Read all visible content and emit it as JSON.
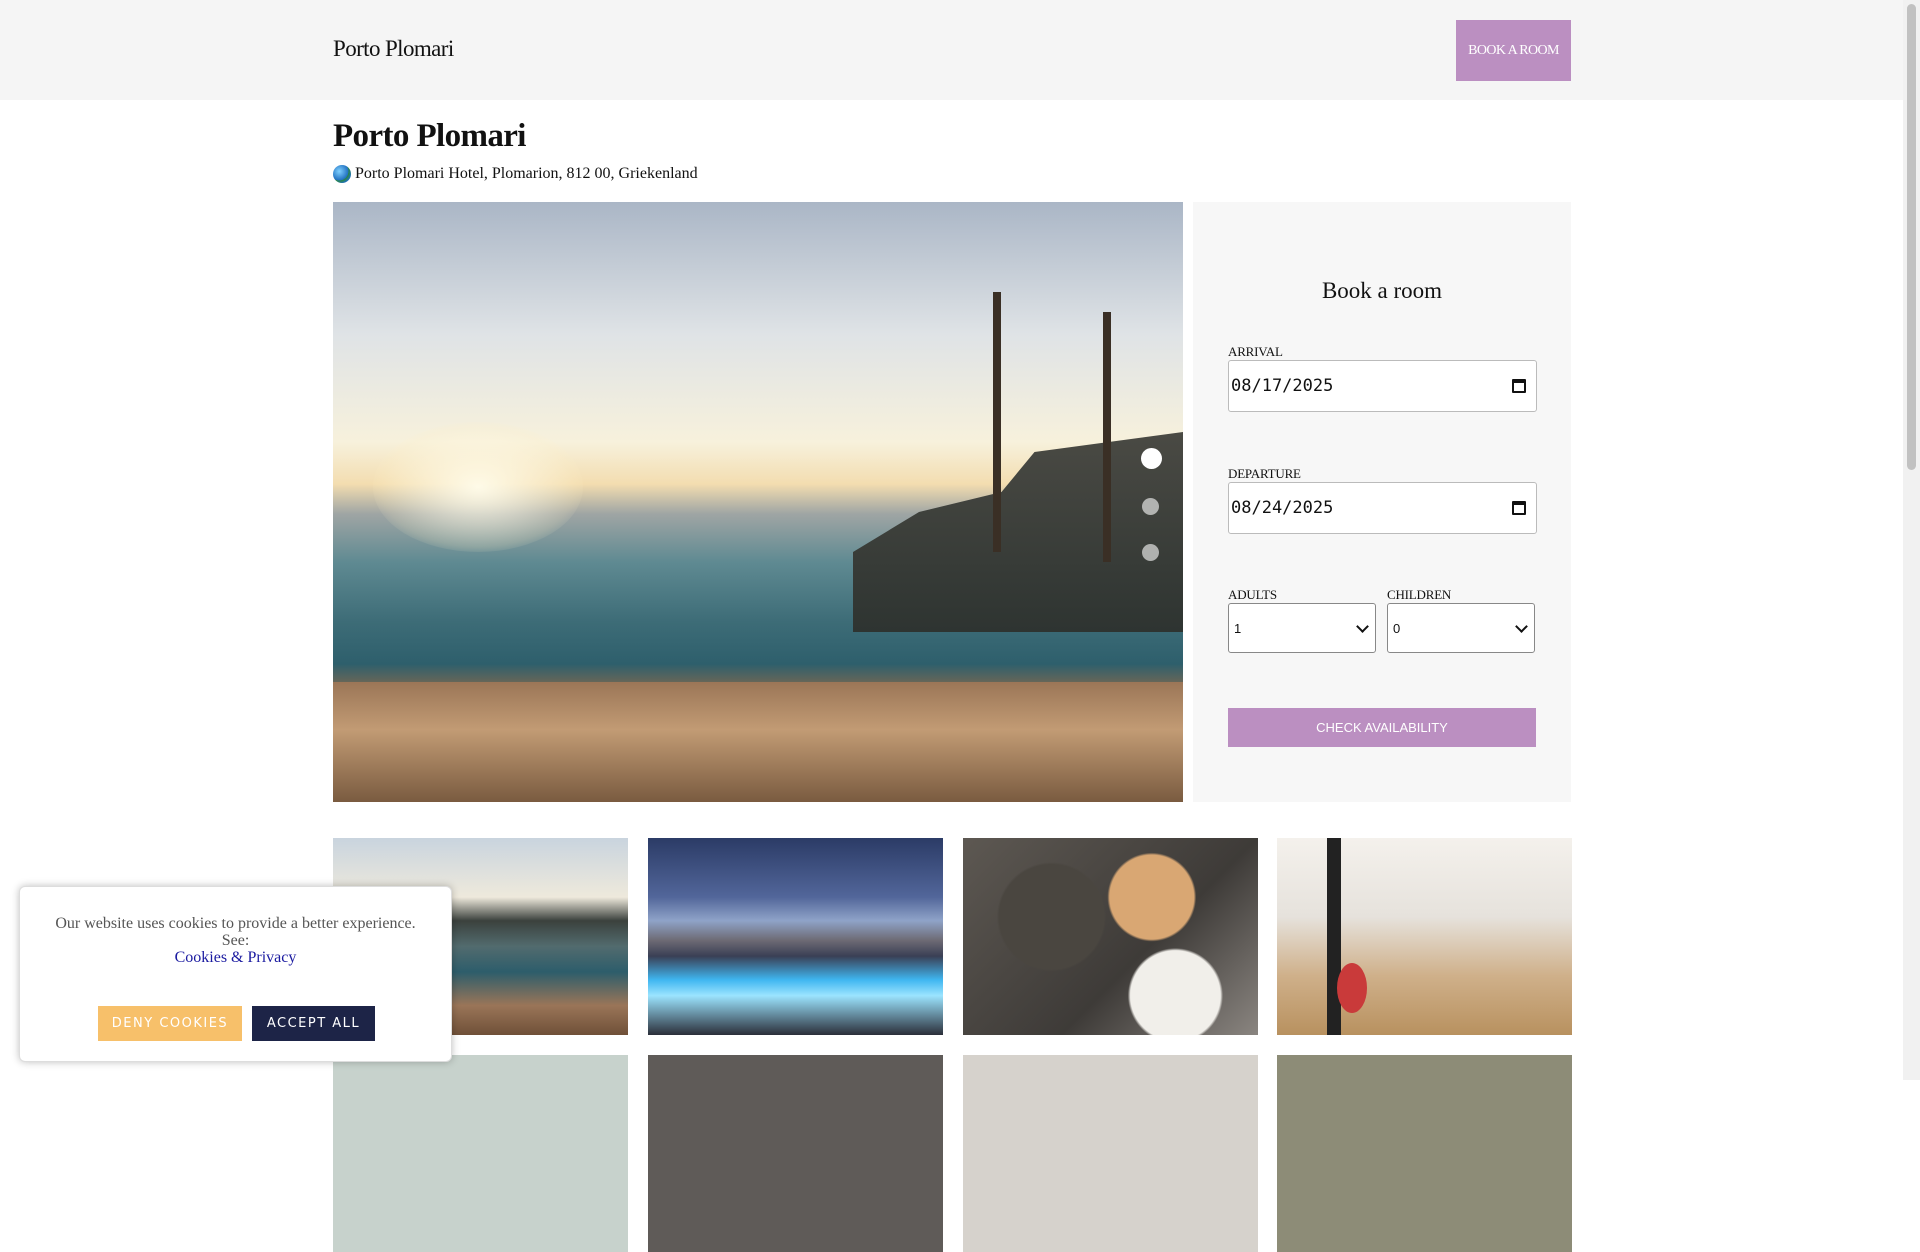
{
  "header": {
    "logo": "Porto Plomari",
    "book_label": "BOOK A ROOM"
  },
  "hotel": {
    "name": "Porto Plomari",
    "address": "Porto Plomari Hotel, Plomarion, 812 00, Griekenland",
    "address_icon": "globe-icon"
  },
  "slider": {
    "dot_count": 3,
    "active_index": 0
  },
  "booking": {
    "title": "Book a room",
    "arrival_label": "ARRIVAL",
    "arrival_value": "08/17/2025",
    "departure_label": "DEPARTURE",
    "departure_value": "08/24/2025",
    "adults_label": "ADULTS",
    "adults_value": "1",
    "children_label": "CHILDREN",
    "children_value": "0",
    "check_label": "CHECK AVAILABILITY"
  },
  "cookie_banner": {
    "text": "Our website uses cookies to provide a better experience. See:",
    "link": "Cookies & Privacy",
    "deny_label": "DENY COOKIES",
    "accept_label": "ACCEPT ALL"
  },
  "colors": {
    "accent": "#bb8fc1",
    "deny": "#f7c06a",
    "accept": "#1d2447"
  }
}
